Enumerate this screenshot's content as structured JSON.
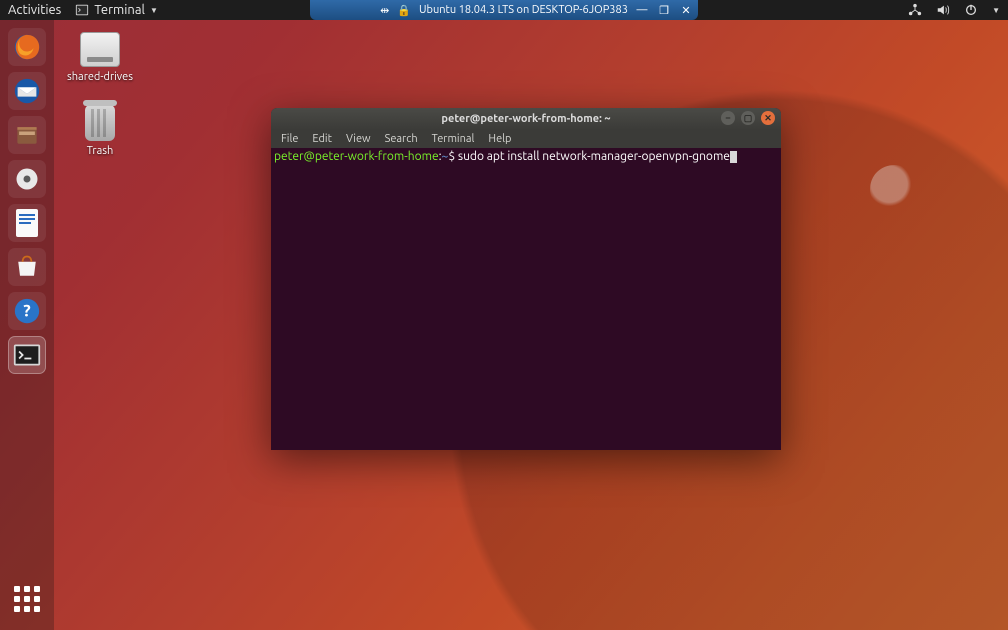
{
  "vm": {
    "title": "Ubuntu 18.04.3 LTS on DESKTOP-6JOP383",
    "pin_icon": "📌",
    "lock_icon": "🔒"
  },
  "gnome": {
    "activities": "Activities",
    "app_indicator": "Terminal"
  },
  "desktop": {
    "shared_drives": "shared-drives",
    "trash": "Trash"
  },
  "dock": {
    "items": [
      {
        "name": "firefox"
      },
      {
        "name": "thunderbird"
      },
      {
        "name": "files"
      },
      {
        "name": "rhythmbox"
      },
      {
        "name": "libreoffice-writer"
      },
      {
        "name": "ubuntu-software"
      },
      {
        "name": "help"
      },
      {
        "name": "terminal"
      }
    ]
  },
  "terminal": {
    "title": "peter@peter-work-from-home: ~",
    "menu": [
      "File",
      "Edit",
      "View",
      "Search",
      "Terminal",
      "Help"
    ],
    "prompt_user": "peter@peter-work-from-home",
    "prompt_sep1": ":",
    "prompt_path": "~",
    "prompt_sep2": "$ ",
    "command": "sudo apt install network-manager-openvpn-gnome"
  }
}
